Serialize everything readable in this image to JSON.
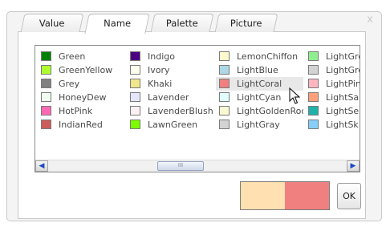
{
  "window": {
    "close_label": "x"
  },
  "tabs": [
    {
      "label": "Value"
    },
    {
      "label": "Name"
    },
    {
      "label": "Palette"
    },
    {
      "label": "Picture"
    }
  ],
  "active_tab": "Name",
  "colors": {
    "columns": [
      [
        {
          "name": "Green",
          "hex": "#008000"
        },
        {
          "name": "GreenYellow",
          "hex": "#ADFF2F"
        },
        {
          "name": "Grey",
          "hex": "#808080"
        },
        {
          "name": "HoneyDew",
          "hex": "#F0FFF0"
        },
        {
          "name": "HotPink",
          "hex": "#FF69B4"
        },
        {
          "name": "IndianRed",
          "hex": "#CD5C5C"
        }
      ],
      [
        {
          "name": "Indigo",
          "hex": "#4B0082"
        },
        {
          "name": "Ivory",
          "hex": "#FFFFF0"
        },
        {
          "name": "Khaki",
          "hex": "#F0E68C"
        },
        {
          "name": "Lavender",
          "hex": "#E6E6FA"
        },
        {
          "name": "LavenderBlush",
          "hex": "#FFF0F5"
        },
        {
          "name": "LawnGreen",
          "hex": "#7CFC00"
        }
      ],
      [
        {
          "name": "LemonChiffon",
          "hex": "#FFFACD"
        },
        {
          "name": "LightBlue",
          "hex": "#ADD8E6"
        },
        {
          "name": "LightCoral",
          "hex": "#F08080"
        },
        {
          "name": "LightCyan",
          "hex": "#E0FFFF"
        },
        {
          "name": "LightGoldenRod",
          "hex": "#FAFAD2"
        },
        {
          "name": "LightGray",
          "hex": "#D3D3D3"
        }
      ],
      [
        {
          "name": "LightGre",
          "hex": "#90EE90"
        },
        {
          "name": "LightGre",
          "hex": "#D3D3D3"
        },
        {
          "name": "LightPin",
          "hex": "#FFB6C1"
        },
        {
          "name": "LightSa",
          "hex": "#FFA07A"
        },
        {
          "name": "LightSe",
          "hex": "#20B2AA"
        },
        {
          "name": "LightSk",
          "hex": "#87CEFA"
        }
      ]
    ],
    "hovered": "LightCoral"
  },
  "scrollbar": {
    "left_arrow": "◀",
    "right_arrow": "▶",
    "thumb_grip": "III"
  },
  "preview": {
    "old_color": "#FFE0B0",
    "new_color": "#F08080"
  },
  "ok_label": "OK"
}
